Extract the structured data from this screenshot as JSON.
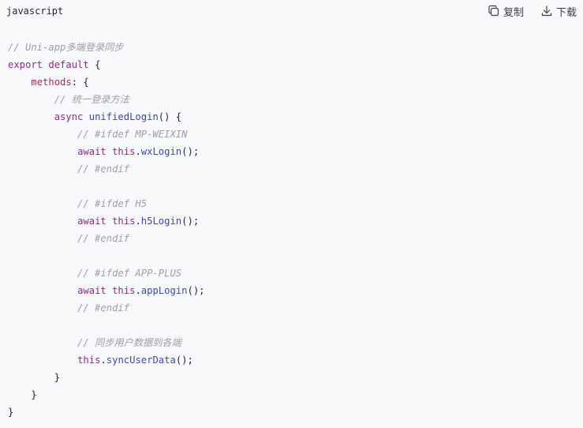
{
  "header": {
    "language": "javascript",
    "copy_label": "复制",
    "download_label": "下载",
    "copy_icon": "copy-icon",
    "download_icon": "download-icon"
  },
  "code": {
    "lines": [
      "// Uni-app多端登录同步",
      "export default {",
      "    methods: {",
      "        // 统一登录方法",
      "        async unifiedLogin() {",
      "            // #ifdef MP-WEIXIN",
      "            await this.wxLogin();",
      "            // #endif",
      "",
      "            // #ifdef H5",
      "            await this.h5Login();",
      "            // #endif",
      "",
      "            // #ifdef APP-PLUS",
      "            await this.appLogin();",
      "            // #endif",
      "",
      "            // 同步用户数据到各端",
      "            this.syncUserData();",
      "        }",
      "    }",
      "}"
    ]
  },
  "colors": {
    "background": "#f8f9fb",
    "comment": "#9a9ea6",
    "keyword": "#8a2a8a",
    "property": "#c2185b",
    "function": "#3b45c4",
    "text": "#1f2329"
  }
}
